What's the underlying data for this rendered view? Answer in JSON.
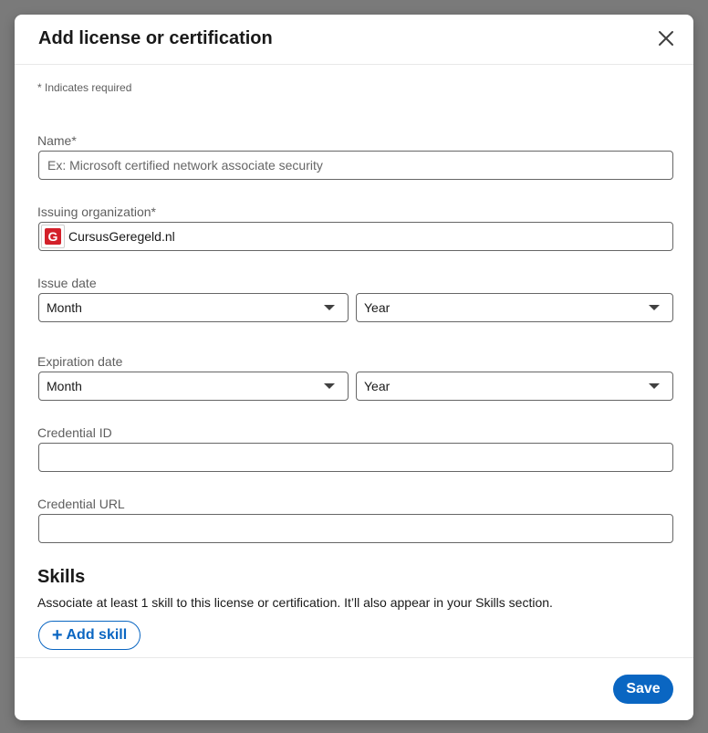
{
  "modal": {
    "title": "Add license or certification",
    "close_label": "Close"
  },
  "form": {
    "required_note": "* Indicates required",
    "name": {
      "label": "Name*",
      "value": "",
      "placeholder": "Ex: Microsoft certified network associate security"
    },
    "issuing_org": {
      "label": "Issuing organization*",
      "value": "CursusGeregeld.nl",
      "logo_letter": "G",
      "logo_color": "#d3202a"
    },
    "issue_date": {
      "label": "Issue date",
      "month": "Month",
      "year": "Year"
    },
    "expiration_date": {
      "label": "Expiration date",
      "month": "Month",
      "year": "Year"
    },
    "credential_id": {
      "label": "Credential ID",
      "value": ""
    },
    "credential_url": {
      "label": "Credential URL",
      "value": ""
    }
  },
  "skills": {
    "title": "Skills",
    "description": "Associate at least 1 skill to this license or certification. It’ll also appear in your Skills section.",
    "add_button": "Add skill"
  },
  "footer": {
    "save_label": "Save"
  },
  "colors": {
    "accent": "#0a66c2",
    "overlay": "#7a7a7a",
    "border": "#666666"
  }
}
